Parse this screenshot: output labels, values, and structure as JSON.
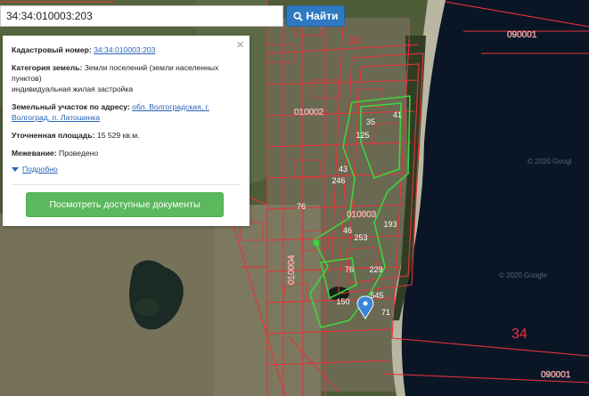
{
  "search": {
    "value": "34:34:010003:203",
    "button_label": "Найти"
  },
  "info_card": {
    "cadastral_label": "Кадастровый номер:",
    "cadastral_value": "34:34:010003:203",
    "category_label": "Категория земель:",
    "category_value": "Земли поселений (земли населенных пунктов)",
    "category_use": "индивидуальная жилая застройка",
    "address_label": "Земельный участок по адресу:",
    "address_value": "обл. Волгоградская, г. Волгоград, п. Латошинка",
    "area_label": "Уточненная площадь:",
    "area_value": "15 529 кв.м.",
    "survey_label": "Межевание:",
    "survey_value": "Проведено",
    "more_link": "Подробно",
    "docs_button": "Посмотреть доступные документы",
    "close_symbol": "×"
  },
  "map_labels": {
    "quarter_number": "34",
    "quarter_number_2": "34",
    "block_090001_top": "090001",
    "block_090001_bottom": "090001",
    "block_010002": "010002",
    "block_010003": "010003",
    "block_010004": "010004",
    "block_010002_top": "010002",
    "watermark_1": "© 2020 Googl",
    "watermark_2": "© 2020 Google",
    "parcels": [
      "35",
      "41",
      "125",
      "43",
      "246",
      "46",
      "253",
      "76",
      "229",
      "150",
      "545",
      "71",
      "193",
      "76"
    ]
  },
  "colors": {
    "parcel_border": "#e8323a",
    "selected_parcel": "#3fd43f",
    "water": "#0a1626",
    "land": "#4a5a34",
    "search_button": "#2f79c2",
    "docs_button": "#5cb85c",
    "marker": "#3a86d9"
  }
}
